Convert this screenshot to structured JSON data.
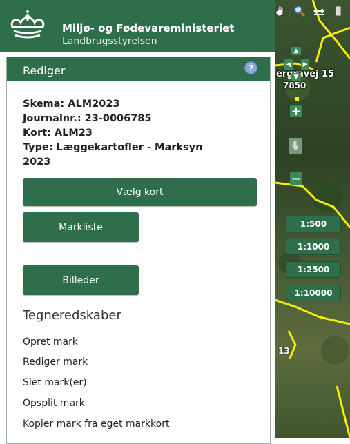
{
  "header": {
    "title": "Miljø- og Fødevareministeriet",
    "subtitle": "Landbrugsstyrelsen"
  },
  "panel": {
    "title": "Rediger",
    "help_icon": "question-circle-icon",
    "info": {
      "skema": "Skema: ALM2023",
      "journal": "Journalnr.: 23-0006785",
      "kort": "Kort: ALM23",
      "type_line1": "Type: Læggekartofler - Marksyn",
      "type_line2": "2023"
    },
    "buttons": {
      "choose_map": "Vælg kort",
      "field_list": "Markliste",
      "images": "Billeder"
    },
    "tools": {
      "heading": "Tegneredskaber",
      "items": [
        "Opret mark",
        "Rediger mark",
        "Slet mark(er)",
        "Opsplit mark",
        "Kopier mark fra eget markkort"
      ]
    }
  },
  "map": {
    "road_label": "ergravej 15",
    "road_number": "7850",
    "parcel_label": "13",
    "scales": [
      "1:500",
      "1:1000",
      "1:2500",
      "1:10000"
    ],
    "toolbar_icons": [
      "hand-pan-icon",
      "magnifier-icon",
      "measure-icon",
      "layers-icon"
    ]
  },
  "colors": {
    "brand_green": "#2f6e4a",
    "field_outline": "#f5f000"
  }
}
